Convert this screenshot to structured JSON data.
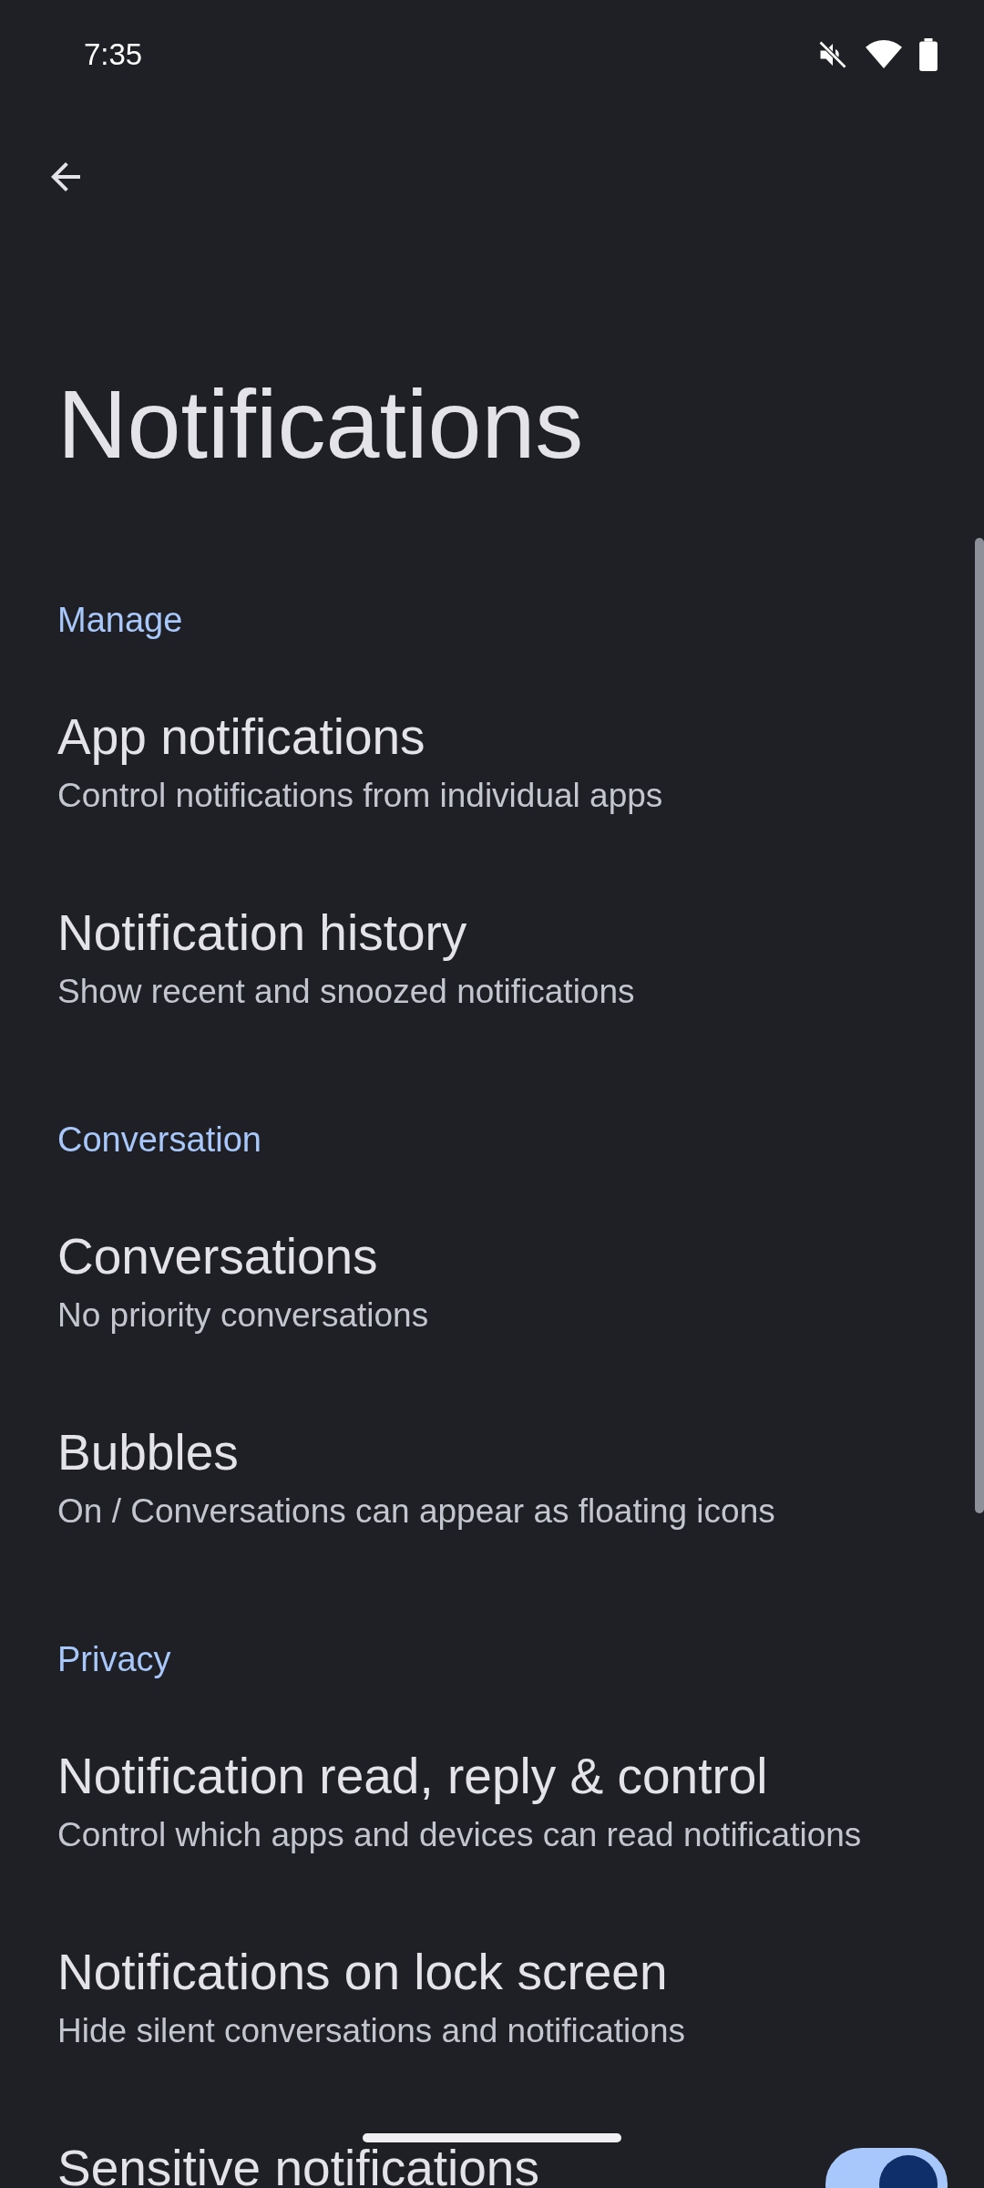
{
  "status_bar": {
    "time": "7:35"
  },
  "title": "Notifications",
  "sections": [
    {
      "header": "Manage",
      "items": [
        {
          "kind": "link",
          "title": "App notifications",
          "subtitle": "Control notifications from individual apps"
        },
        {
          "kind": "link",
          "title": "Notification history",
          "subtitle": "Show recent and snoozed notifications"
        }
      ]
    },
    {
      "header": "Conversation",
      "items": [
        {
          "kind": "link",
          "title": "Conversations",
          "subtitle": "No priority conversations"
        },
        {
          "kind": "link",
          "title": "Bubbles",
          "subtitle": "On / Conversations can appear as floating icons"
        }
      ]
    },
    {
      "header": "Privacy",
      "items": [
        {
          "kind": "link",
          "title": "Notification read, reply & control",
          "subtitle": "Control which apps and devices can read notifications"
        },
        {
          "kind": "link",
          "title": "Notifications on lock screen",
          "subtitle": "Hide silent conversations and notifications"
        },
        {
          "kind": "switch",
          "title": "Sensitive notifications",
          "on": true
        }
      ]
    }
  ]
}
